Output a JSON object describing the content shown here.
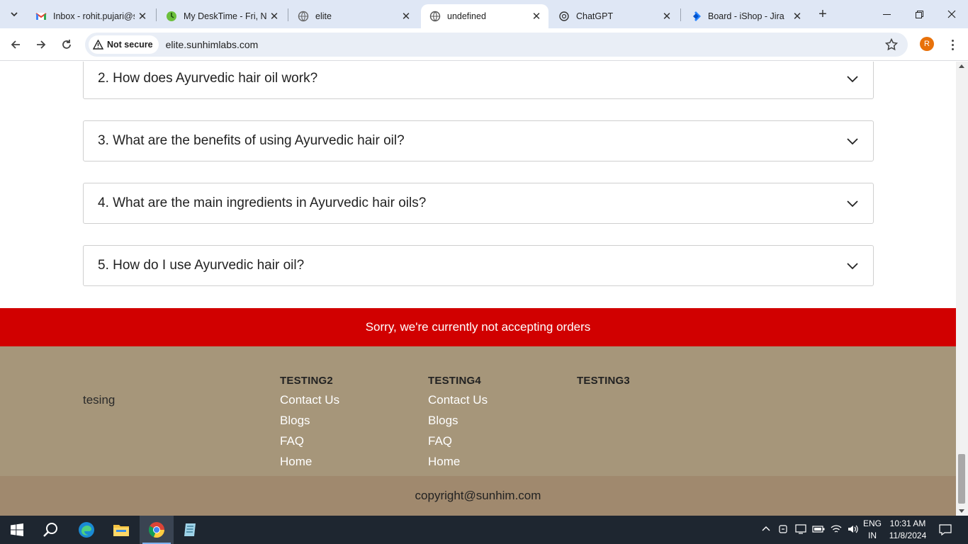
{
  "browser": {
    "tabs": [
      {
        "title": "Inbox - rohit.pujari@s",
        "icon": "gmail-icon"
      },
      {
        "title": "My DeskTime - Fri, No",
        "icon": "desktime-icon"
      },
      {
        "title": "elite",
        "icon": "globe-icon"
      },
      {
        "title": "undefined",
        "icon": "globe-icon"
      },
      {
        "title": "ChatGPT",
        "icon": "chatgpt-icon"
      },
      {
        "title": "Board - iShop - Jira",
        "icon": "jira-icon"
      }
    ],
    "active_tab": 3,
    "security_label": "Not secure",
    "url": "elite.sunhimlabs.com",
    "profile_initial": "R"
  },
  "faq": {
    "items": [
      "2. How does Ayurvedic hair oil work?",
      "3. What are the benefits of using Ayurvedic hair oil?",
      "4. What are the main ingredients in Ayurvedic hair oils?",
      "5. How do I use Ayurvedic hair oil?"
    ]
  },
  "banner": {
    "text": "Sorry, we're currently not accepting orders"
  },
  "footer": {
    "brand": "tesing",
    "columns": [
      {
        "heading": "TESTING2",
        "links": [
          "Contact Us",
          "Blogs",
          "FAQ",
          "Home"
        ]
      },
      {
        "heading": "TESTING4",
        "links": [
          "Contact Us",
          "Blogs",
          "FAQ",
          "Home"
        ]
      },
      {
        "heading": "TESTING3",
        "links": []
      }
    ],
    "copyright": "copyright@sunhim.com"
  },
  "taskbar": {
    "language": "ENG",
    "region": "IN",
    "time": "10:31 AM",
    "date": "11/8/2024"
  },
  "colors": {
    "banner": "#d10000",
    "footer": "#a6967a",
    "copyright_bar": "#a0896e"
  }
}
